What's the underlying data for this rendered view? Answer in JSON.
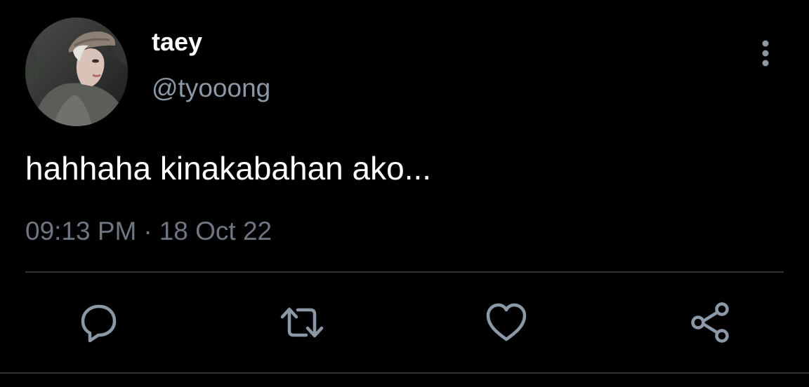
{
  "user": {
    "display_name": "taey",
    "handle": "@tyooong"
  },
  "tweet": {
    "text": "hahhaha kinakabahan ako...",
    "time": "09:13 PM",
    "separator": "·",
    "date": "18 Oct 22"
  },
  "icons": {
    "more": "more-vertical-icon",
    "reply": "reply-icon",
    "retweet": "retweet-icon",
    "like": "heart-icon",
    "share": "share-icon"
  },
  "colors": {
    "background": "#000000",
    "primary_text": "#ffffff",
    "secondary_text": "#8b98a5",
    "meta_text": "#6e7681",
    "icon": "#8b98a5",
    "divider": "#2f3336"
  }
}
